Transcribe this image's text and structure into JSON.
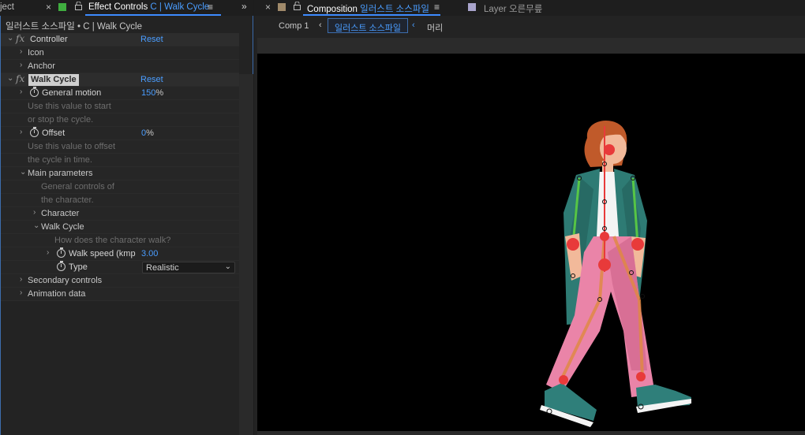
{
  "left_panel": {
    "tab_project": "ject",
    "tab_effect_prefix": "Effect Controls",
    "tab_effect_layer": "C | Walk Cycle",
    "header": "일러스트 소스파일 • C | Walk Cycle",
    "rows": {
      "controller": "Controller",
      "controller_reset": "Reset",
      "icon": "Icon",
      "anchor": "Anchor",
      "walk_cycle": "Walk Cycle",
      "walk_cycle_reset": "Reset",
      "general_motion": "General motion",
      "general_motion_value": "150",
      "general_motion_unit": "%",
      "gm_desc_1": "Use this value to start",
      "gm_desc_2": "or stop the cycle.",
      "offset": "Offset",
      "offset_value": "0",
      "offset_unit": "%",
      "off_desc_1": "Use this value to offset",
      "off_desc_2": "the cycle in time.",
      "main_parameters": "Main parameters",
      "mp_desc_1": "General controls of",
      "mp_desc_2": "the character.",
      "character": "Character",
      "walk_cycle_sub": "Walk Cycle",
      "wc_desc": "How does the character walk?",
      "walk_speed": "Walk speed (kmp",
      "walk_speed_value": "3.00",
      "type": "Type",
      "type_value": "Realistic",
      "secondary_controls": "Secondary controls",
      "animation_data": "Animation data"
    }
  },
  "right_panel": {
    "tab_comp_prefix": "Composition",
    "tab_comp_name": "일러스트 소스파일",
    "tab_layer": "Layer 오른무릎",
    "breadcrumbs": [
      "Comp 1",
      "일러스트 소스파일",
      "머리"
    ]
  },
  "icons": {
    "close": "×",
    "lock": "🔓",
    "menu": "≡",
    "more": "»",
    "chevron_left": "‹",
    "twirl_closed": "›",
    "twirl_open": "⌄",
    "dropdown": "⌄"
  },
  "colors": {
    "accent": "#4a9dff",
    "effect_label": "#3fae3f",
    "comp_label": "#a08a6a",
    "layer_label": "#a9a4cc"
  }
}
